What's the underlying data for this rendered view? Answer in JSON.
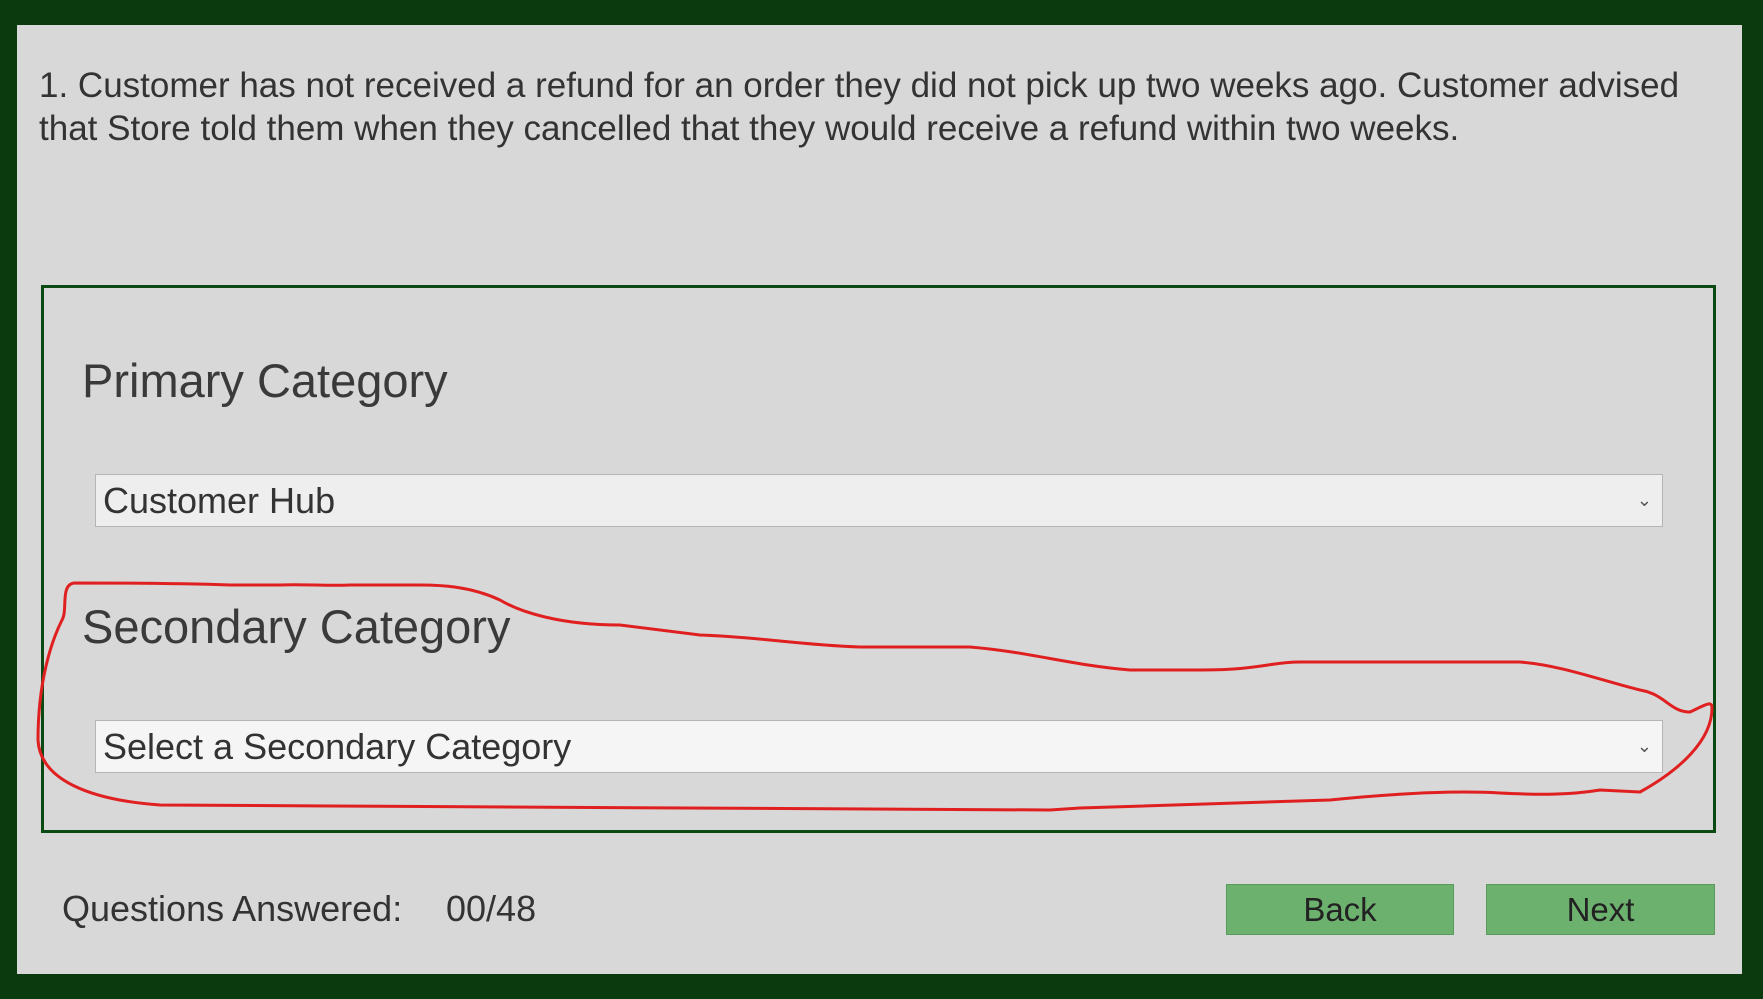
{
  "question": {
    "text": "1. Customer has not received a refund for an order they did not pick up two weeks ago. Customer advised that Store told them when they cancelled that they would receive a refund within two weeks."
  },
  "primary": {
    "heading": "Primary Category",
    "selected": "Customer Hub"
  },
  "secondary": {
    "heading": "Secondary Category",
    "selected": "Select a Secondary Category"
  },
  "footer": {
    "answered_label": "Questions Answered:",
    "answered_count": "00/48",
    "back_label": "Back",
    "next_label": "Next"
  },
  "icons": {
    "select_arrow": "chevron-down-icon"
  },
  "colors": {
    "frame": "#0b3a0e",
    "panel": "#d8d8d8",
    "button": "#6db16f",
    "annotation": "#e02020"
  }
}
